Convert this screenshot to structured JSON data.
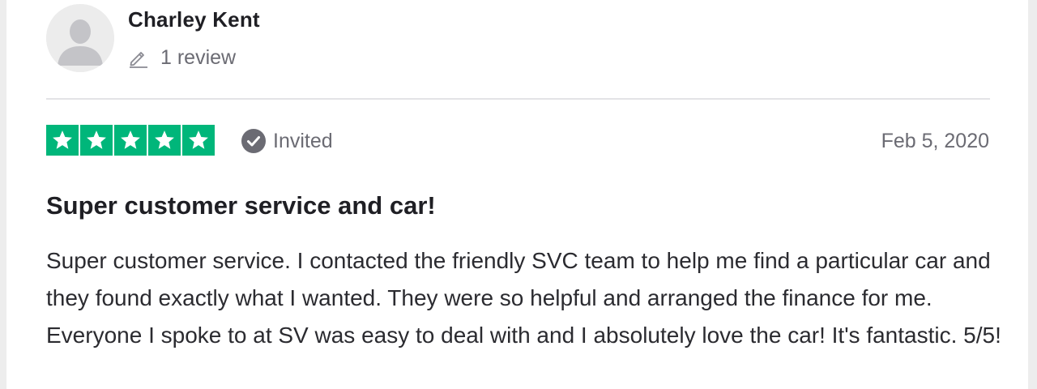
{
  "reviewer": {
    "name": "Charley Kent",
    "review_count": "1 review"
  },
  "review": {
    "rating": 5,
    "max_rating": 5,
    "status": "Invited",
    "date": "Feb 5, 2020",
    "title": "Super customer service and car!",
    "body": "Super customer service. I contacted the friendly SVC team to help me find a particular car and they found exactly what I wanted. They were so helpful and arranged the finance for me. Everyone I spoke to at SV was easy to deal with and I absolutely love the car! It's fantastic. 5/5!"
  },
  "colors": {
    "star_green": "#00b67a",
    "badge_gray": "#6b6b73"
  },
  "icons": {
    "avatar": "user-silhouette-icon",
    "review_count": "pencil-icon",
    "star": "star-icon",
    "invited": "check-circle-icon"
  }
}
